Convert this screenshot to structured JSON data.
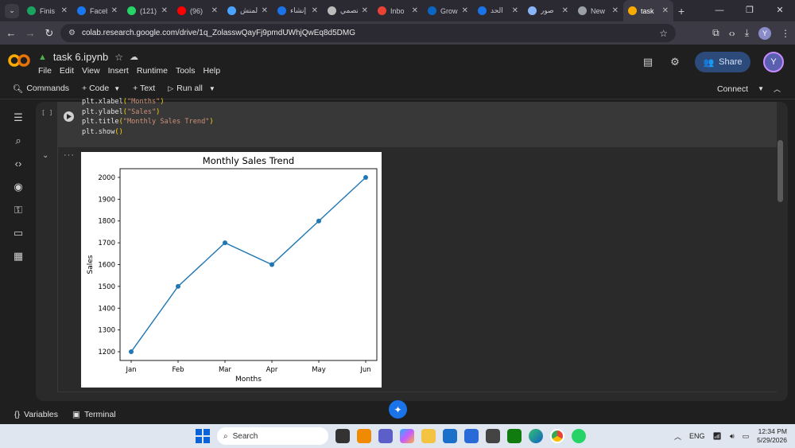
{
  "browser": {
    "tabs": [
      {
        "label": "Finis",
        "color": "#1aa260",
        "active": false
      },
      {
        "label": "Faceb",
        "color": "#1877f2",
        "active": false
      },
      {
        "label": "(121)",
        "color": "#25d366",
        "active": false
      },
      {
        "label": "(96)",
        "color": "#ff0000",
        "active": false
      },
      {
        "label": "المنش",
        "color": "#4aa3ff",
        "active": false
      },
      {
        "label": "إنشاء",
        "color": "#1a73e8",
        "active": false
      },
      {
        "label": "تصمي",
        "color": "#bbbbbb",
        "active": false
      },
      {
        "label": "Inbo",
        "color": "#ea4335",
        "active": false
      },
      {
        "label": "Grow",
        "color": "#0a66c2",
        "active": false
      },
      {
        "label": "الحد",
        "color": "#1a73e8",
        "active": false
      },
      {
        "label": "صور",
        "color": "#8ab4f8",
        "active": false
      },
      {
        "label": "New",
        "color": "#9aa0a6",
        "active": false
      },
      {
        "label": "task",
        "color": "#f9ab00",
        "active": true
      }
    ],
    "url": "colab.research.google.com/drive/1q_ZolasswQayFj9pmdUWhjQwEq8d5DMG",
    "profile_initial": "Y"
  },
  "colab": {
    "notebook_title": "task 6.ipynb",
    "menu": [
      "File",
      "Edit",
      "View",
      "Insert",
      "Runtime",
      "Tools",
      "Help"
    ],
    "share_label": "Share",
    "avatar_initial": "Y",
    "toolbar": {
      "commands": "Commands",
      "code": "+ Code",
      "text": "+ Text",
      "run_all": "Run all",
      "connect": "Connect"
    },
    "cell": {
      "exec_count": "[ ]",
      "code_lines": [
        {
          "fn": "plt.xlabel",
          "arg": "\"Months\""
        },
        {
          "fn": "plt.ylabel",
          "arg": "\"Sales\""
        },
        {
          "fn": "plt.title",
          "arg": "\"Monthly Sales Trend\""
        },
        {
          "fn": "plt.show",
          "arg": ""
        }
      ]
    },
    "bottom": {
      "variables": "Variables",
      "terminal": "Terminal"
    }
  },
  "chart_data": {
    "type": "line",
    "title": "Monthly Sales Trend",
    "xlabel": "Months",
    "ylabel": "Sales",
    "categories": [
      "Jan",
      "Feb",
      "Mar",
      "Apr",
      "May",
      "Jun"
    ],
    "series": [
      {
        "values": [
          1200,
          1500,
          1700,
          1600,
          1800,
          2000
        ],
        "color": "#1f77b4"
      }
    ],
    "yticks": [
      1200,
      1300,
      1400,
      1500,
      1600,
      1700,
      1800,
      1900,
      2000
    ],
    "ylim": [
      1160,
      2040
    ],
    "grid": false,
    "markers": true
  },
  "taskbar": {
    "search_placeholder": "Search",
    "language": "ENG",
    "time": "12:34 PM",
    "date": "5/29/2026"
  }
}
